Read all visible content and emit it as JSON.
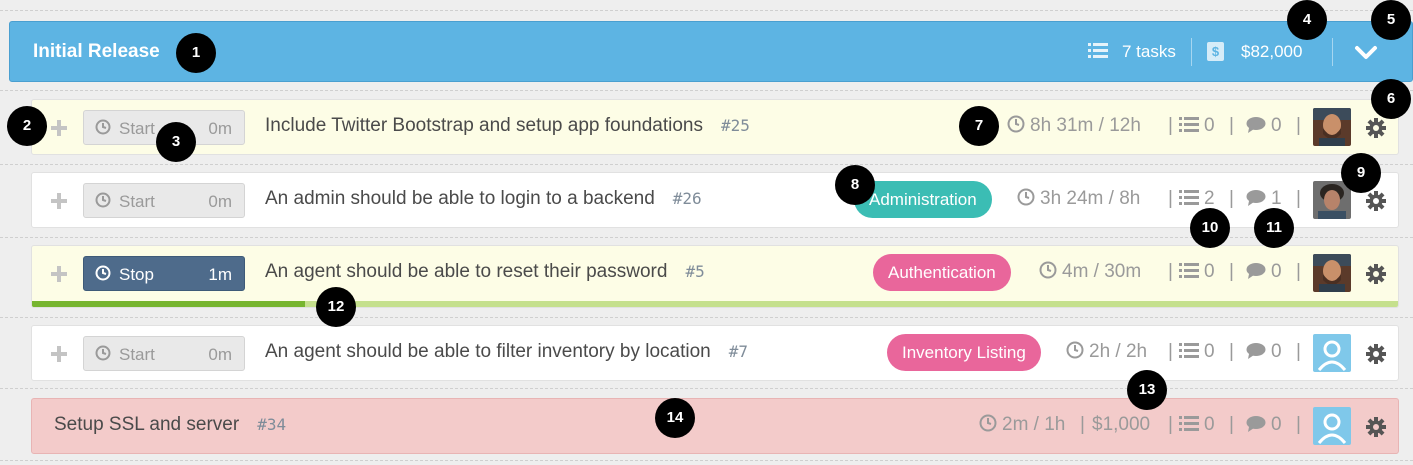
{
  "milestone": {
    "title": "Initial Release",
    "tasks": "7 tasks",
    "budget": "$82,000",
    "budget_icon": "$"
  },
  "tasks": [
    {
      "timer_label": "Start",
      "timer_time": "0m",
      "title": "Include Twitter Bootstrap and setup app foundations",
      "number": "#25",
      "time": "8h 31m / 12h",
      "checklist": "0",
      "comments": "0"
    },
    {
      "timer_label": "Start",
      "timer_time": "0m",
      "title": "An admin should be able to login to a backend",
      "number": "#26",
      "tag": "Administration",
      "tag_color": "#3bbdb4",
      "time": "3h 24m / 8h",
      "checklist": "2",
      "comments": "1"
    },
    {
      "timer_label": "Stop",
      "timer_time": "1m",
      "title": "An agent should be able to reset their password",
      "number": "#5",
      "tag": "Authentication",
      "tag_color": "#e9669b",
      "time": "4m / 30m",
      "checklist": "0",
      "comments": "0",
      "progress": 0.2
    },
    {
      "timer_label": "Start",
      "timer_time": "0m",
      "title": "An agent should be able to filter inventory by location",
      "number": "#7",
      "tag": "Inventory Listing",
      "tag_color": "#e9669b",
      "time": "2h / 2h",
      "checklist": "0",
      "comments": "0"
    },
    {
      "title": "Setup SSL and server",
      "number": "#34",
      "time": "2m / 1h",
      "budget": "$1,000",
      "checklist": "0",
      "comments": "0"
    }
  ],
  "callouts": [
    "1",
    "2",
    "3",
    "4",
    "5",
    "6",
    "7",
    "8",
    "9",
    "10",
    "11",
    "12",
    "13",
    "14"
  ]
}
